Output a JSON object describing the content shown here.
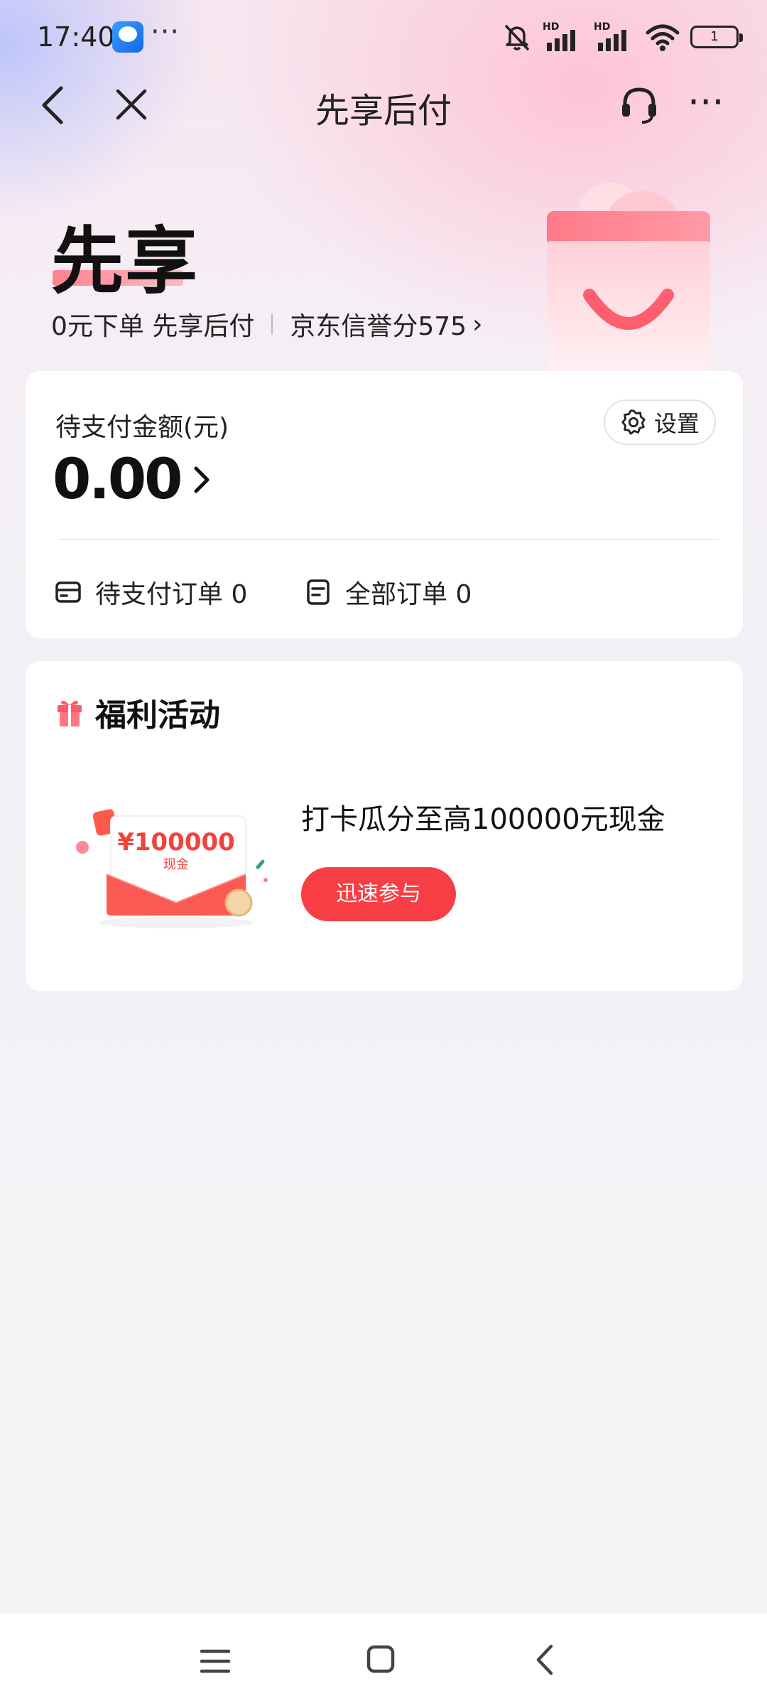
{
  "status_bar": {
    "time": "17:40",
    "more": "···",
    "hd1": "HD",
    "hd2": "HD",
    "battery": "1",
    "icons": [
      "app-icon",
      "mute-icon",
      "signal-icon",
      "signal-icon",
      "wifi-icon",
      "battery-icon"
    ]
  },
  "nav": {
    "title": "先享后付",
    "more": "···",
    "icons": [
      "back-icon",
      "close-icon",
      "headset-icon",
      "more-icon"
    ]
  },
  "hero": {
    "title": "先享",
    "subtitle_left": "0元下单 先享后付",
    "credit": "京东信誉分575",
    "credit_chevron": "›"
  },
  "pending": {
    "label": "待支付金额(元)",
    "amount": "0.00",
    "settings_label": "设置",
    "orders": [
      {
        "label": "待支付订单 0"
      },
      {
        "label": "全部订单 0"
      }
    ]
  },
  "benefits": {
    "title": "福利活动",
    "promo_text": "打卡瓜分至高100000元现金",
    "join_label": "迅速参与",
    "image_amount": "¥100000",
    "image_caption": "现金"
  },
  "colors": {
    "accent_red": "#f73e44",
    "hero_pink": "#ff6f7e"
  }
}
